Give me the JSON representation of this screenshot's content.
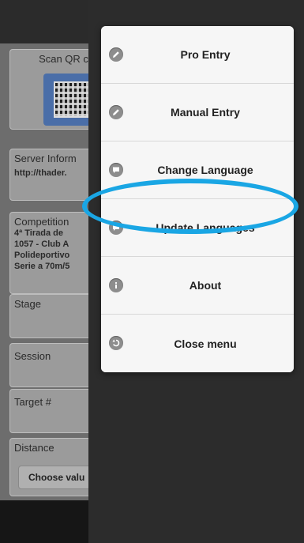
{
  "background": {
    "scan_card": {
      "label": "Scan QR c"
    },
    "server_card": {
      "label": "Server Inform",
      "value": "http://thader."
    },
    "competition_card": {
      "label": "Competition",
      "lines": [
        "4ª Tirada de",
        "1057 - Club A",
        "Polideportivo",
        "Serie a 70m/5"
      ]
    },
    "stage_card": {
      "label": "Stage"
    },
    "session_card": {
      "label": "Session"
    },
    "target_card": {
      "label": "Target #"
    },
    "distance_card": {
      "label": "Distance",
      "button_label": "Choose valu"
    }
  },
  "menu": {
    "items": [
      {
        "label": "Pro Entry",
        "icon": "pencil-icon"
      },
      {
        "label": "Manual Entry",
        "icon": "pencil-icon"
      },
      {
        "label": "Change Language",
        "icon": "speech-bubble-icon"
      },
      {
        "label": "Update Languages",
        "icon": "speech-bubble-icon"
      },
      {
        "label": "About",
        "icon": "info-icon"
      },
      {
        "label": "Close menu",
        "icon": "back-arrow-icon"
      }
    ]
  },
  "colors": {
    "highlight": "#1aa6e4",
    "panel": "#2c2c2c",
    "menu_background": "#f6f6f6"
  }
}
